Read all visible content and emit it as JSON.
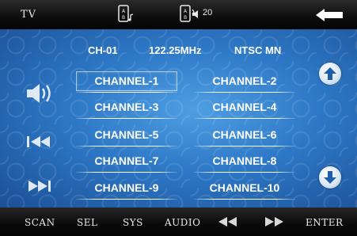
{
  "topbar": {
    "mode": "TV",
    "volume_level": "20",
    "icons": [
      "audio-note-card-icon",
      "ir-signal-card-icon",
      "speaker-icon",
      "back-arrow-icon"
    ]
  },
  "info": {
    "channel": "CH-01",
    "frequency": "122.25MHz",
    "standard": "NTSC MN"
  },
  "channels": {
    "c1": "CHANNEL-1",
    "c2": "CHANNEL-2",
    "c3": "CHANNEL-3",
    "c4": "CHANNEL-4",
    "c5": "CHANNEL-5",
    "c6": "CHANNEL-6",
    "c7": "CHANNEL-7",
    "c8": "CHANNEL-8",
    "c9": "CHANNEL-9",
    "c10": "CHANNEL-10",
    "selected": "CHANNEL-1"
  },
  "bottombar": {
    "scan": "SCAN",
    "sel": "SEL",
    "sys": "SYS",
    "audio": "AUDIO",
    "enter": "ENTER"
  },
  "colors": {
    "panel_blue": "#2d78c6",
    "bar_black": "#0d0d0d",
    "text": "#ffffff"
  }
}
